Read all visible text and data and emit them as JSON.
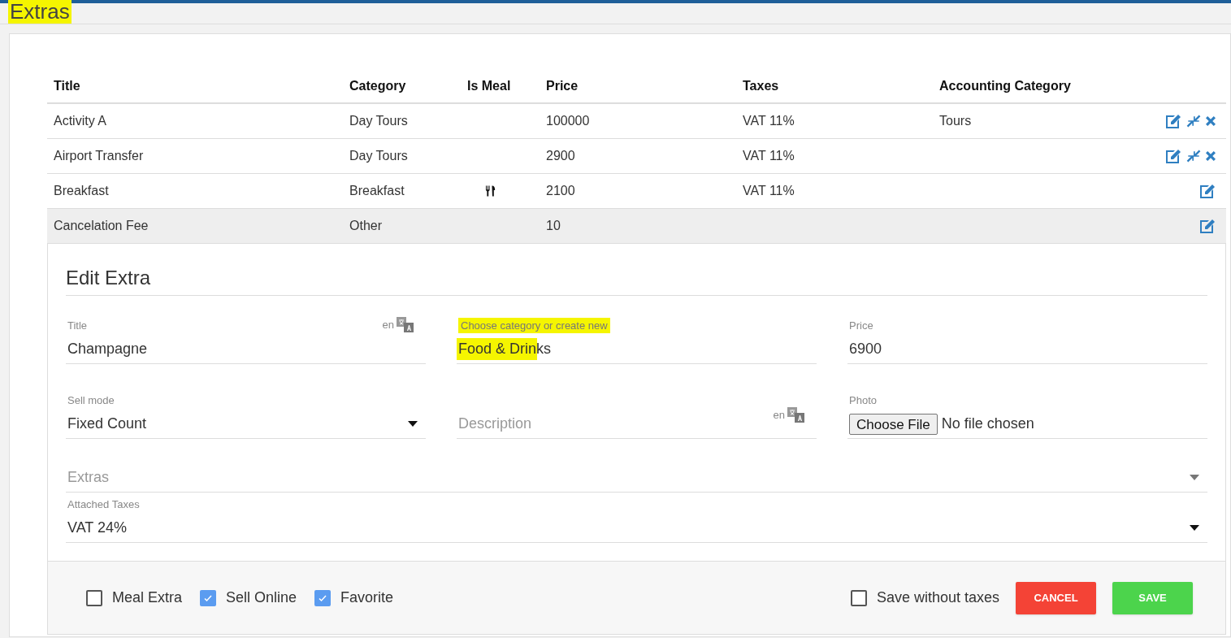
{
  "page": {
    "title": "Extras",
    "highlighted": true
  },
  "table": {
    "columns": [
      "Title",
      "Category",
      "Is Meal",
      "Price",
      "Taxes",
      "Accounting Category"
    ],
    "rows": [
      {
        "title": "Activity A",
        "category": "Day Tours",
        "is_meal": false,
        "price": "100000",
        "taxes": "VAT 11%",
        "accounting_category": "Tours",
        "selected": false,
        "merge": true,
        "delete": true
      },
      {
        "title": "Airport Transfer",
        "category": "Day Tours",
        "is_meal": false,
        "price": "2900",
        "taxes": "VAT 11%",
        "selected": false,
        "merge": true,
        "delete": true
      },
      {
        "title": "Breakfast",
        "category": "Breakfast",
        "is_meal": true,
        "price": "2100",
        "taxes": "VAT 11%",
        "selected": false,
        "merge": false,
        "delete": false
      },
      {
        "title": "Cancelation Fee",
        "category": "Other",
        "is_meal": false,
        "price": "10",
        "selected": true,
        "merge": false,
        "delete": false
      }
    ]
  },
  "edit_form": {
    "heading": "Edit Extra",
    "title_field": {
      "label": "Title",
      "value": "Champagne",
      "language": "en"
    },
    "category_field": {
      "label": "Choose category or create new",
      "value": "Food & Drinks",
      "highlighted": true
    },
    "price_field": {
      "label": "Price",
      "value": "6900"
    },
    "sell_mode_field": {
      "label": "Sell mode",
      "value": "Fixed Count"
    },
    "description_field": {
      "placeholder": "Description",
      "language": "en"
    },
    "photo_field": {
      "label": "Photo",
      "button": "Choose File",
      "status": "No file chosen"
    },
    "extras_field": {
      "placeholder": "Extras"
    },
    "taxes_field": {
      "label": "Attached Taxes",
      "value": "VAT 24%"
    },
    "checkboxes": [
      {
        "label": "Meal Extra",
        "checked": false
      },
      {
        "label": "Sell Online",
        "checked": true
      },
      {
        "label": "Favorite",
        "checked": true
      }
    ],
    "save_without_taxes": {
      "label": "Save without taxes",
      "checked": false
    },
    "buttons": [
      {
        "label": "CANCEL",
        "kind": "cancel"
      },
      {
        "label": "SAVE",
        "kind": "save"
      }
    ]
  }
}
